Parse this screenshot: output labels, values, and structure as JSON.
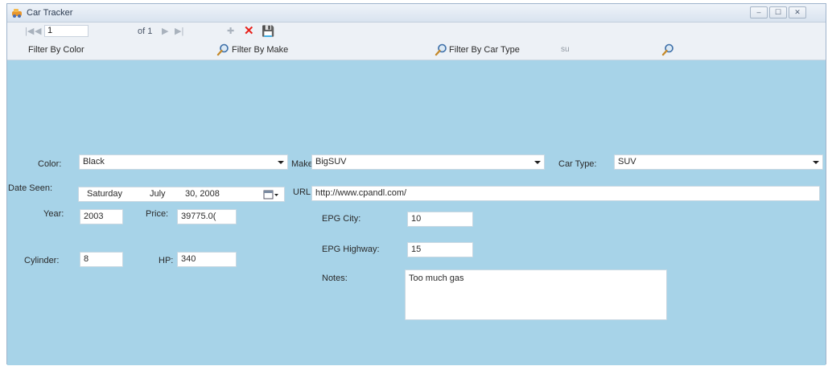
{
  "window": {
    "title": "Car Tracker",
    "minimize": "–",
    "maximize": "☐",
    "close": "✕"
  },
  "navigator": {
    "first": "|◀",
    "prev": "◀",
    "position": "1",
    "of_label": "of 1",
    "next": "▶",
    "last": "▶|",
    "add": "✚",
    "delete": "✕",
    "save": "💾"
  },
  "filters": {
    "color_label": "Filter By Color",
    "make_label": "Filter By Make",
    "cartype_label": "Filter By Car Type",
    "cartype_value": "su"
  },
  "form": {
    "color": {
      "label": "Color:",
      "value": "Black"
    },
    "make": {
      "label": "Make:",
      "value": "BigSUV"
    },
    "car_type": {
      "label": "Car Type:",
      "value": "SUV"
    },
    "date_seen": {
      "label": "Date Seen:",
      "day": "Saturday",
      "month": "July",
      "date": "30, 2008"
    },
    "url": {
      "label": "URL:",
      "value": "http://www.cpandl.com/"
    },
    "year": {
      "label": "Year:",
      "value": "2003"
    },
    "price": {
      "label": "Price:",
      "value": "39775.0("
    },
    "cylinders": {
      "label": "Cylinder:",
      "value": "8"
    },
    "hp": {
      "label": "HP:",
      "value": "340"
    },
    "epg_city": {
      "label": "EPG City:",
      "value": "10"
    },
    "epg_highway": {
      "label": "EPG Highway:",
      "value": "15"
    },
    "notes": {
      "label": "Notes:",
      "value": "Too much gas"
    }
  },
  "colors": {
    "form_background": "#a7d3e8",
    "delete_red": "#e8201a",
    "save_blue": "#2f5aa8"
  }
}
